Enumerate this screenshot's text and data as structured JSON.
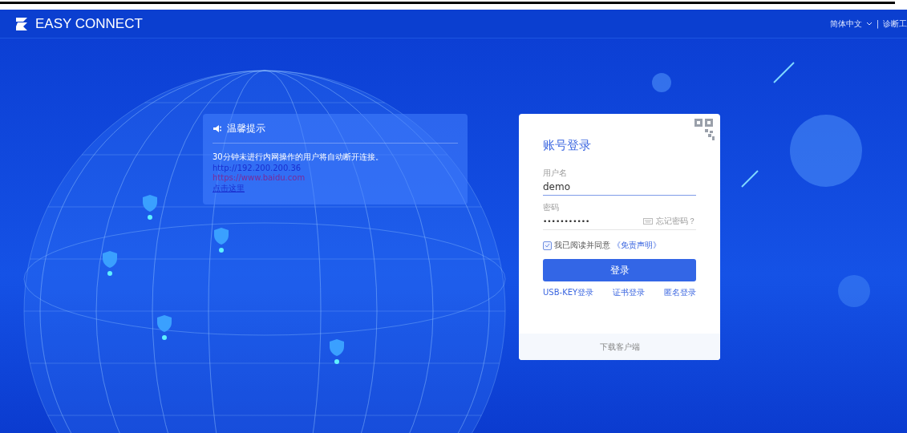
{
  "header": {
    "brand": "EASY CONNECT",
    "language": "简体中文",
    "separator": "|",
    "diagnostic_tool": "诊断工"
  },
  "notice": {
    "title": "温馨提示",
    "message": "30分钟未进行内网操作的用户将自动断开连接。",
    "links": [
      "http://192.200.200.36",
      "https://www.baidu.com",
      "点击这里"
    ]
  },
  "login": {
    "title": "账号登录",
    "username": {
      "label": "用户名",
      "value": "demo"
    },
    "password": {
      "label": "密码",
      "value": "•••••••••••",
      "forgot": "忘记密码？"
    },
    "agree": {
      "checked": true,
      "text": "我已阅读并同意",
      "link": "《免责声明》"
    },
    "submit": "登录",
    "alt_logins": [
      "USB-KEY登录",
      "证书登录",
      "匿名登录"
    ],
    "download": "下载客户端"
  }
}
